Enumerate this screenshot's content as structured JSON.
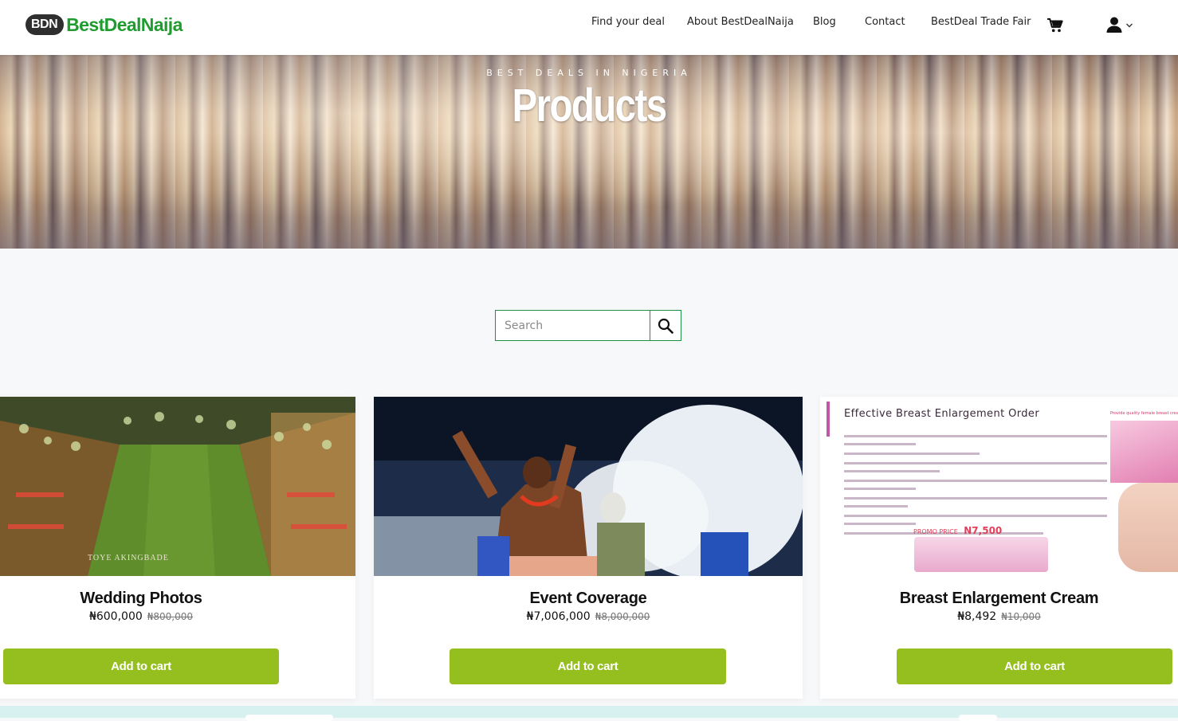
{
  "brand": {
    "badge": "BDN",
    "name": "BestDealNaija",
    "color": "#1f9b2f"
  },
  "nav": {
    "items": [
      "Find your deal",
      "About BestDealNaija",
      "Blog",
      "Contact",
      "BestDeal Trade Fair"
    ],
    "cart_icon": "cart-icon",
    "user_icon": "user-icon"
  },
  "hero": {
    "subtitle": "BEST DEALS IN NIGERIA",
    "title": "Products"
  },
  "search": {
    "placeholder": "Search",
    "value": ""
  },
  "products": [
    {
      "name": "Wedding Photos",
      "price": "₦600,000",
      "old_price": "₦800,000",
      "button": "Add to cart",
      "image_watermark": "TOYE AKINGBADE"
    },
    {
      "name": "Event Coverage",
      "price": "₦7,006,000",
      "old_price": "₦8,000,000",
      "button": "Add to cart"
    },
    {
      "name": "Breast Enlargement Cream",
      "price": "₦8,492",
      "old_price": "₦10,000",
      "button": "Add to cart",
      "image_heading": "Effective Breast Enlargement Order",
      "image_promo_label": "PROMO PRICE",
      "image_promo_price": "N7,500",
      "image_side_text": "Provide quality female breast cream"
    }
  ],
  "colors": {
    "accent_green": "#95bf1e",
    "border_green": "#1f8f43",
    "footer_strip": "#d7f1f0"
  }
}
